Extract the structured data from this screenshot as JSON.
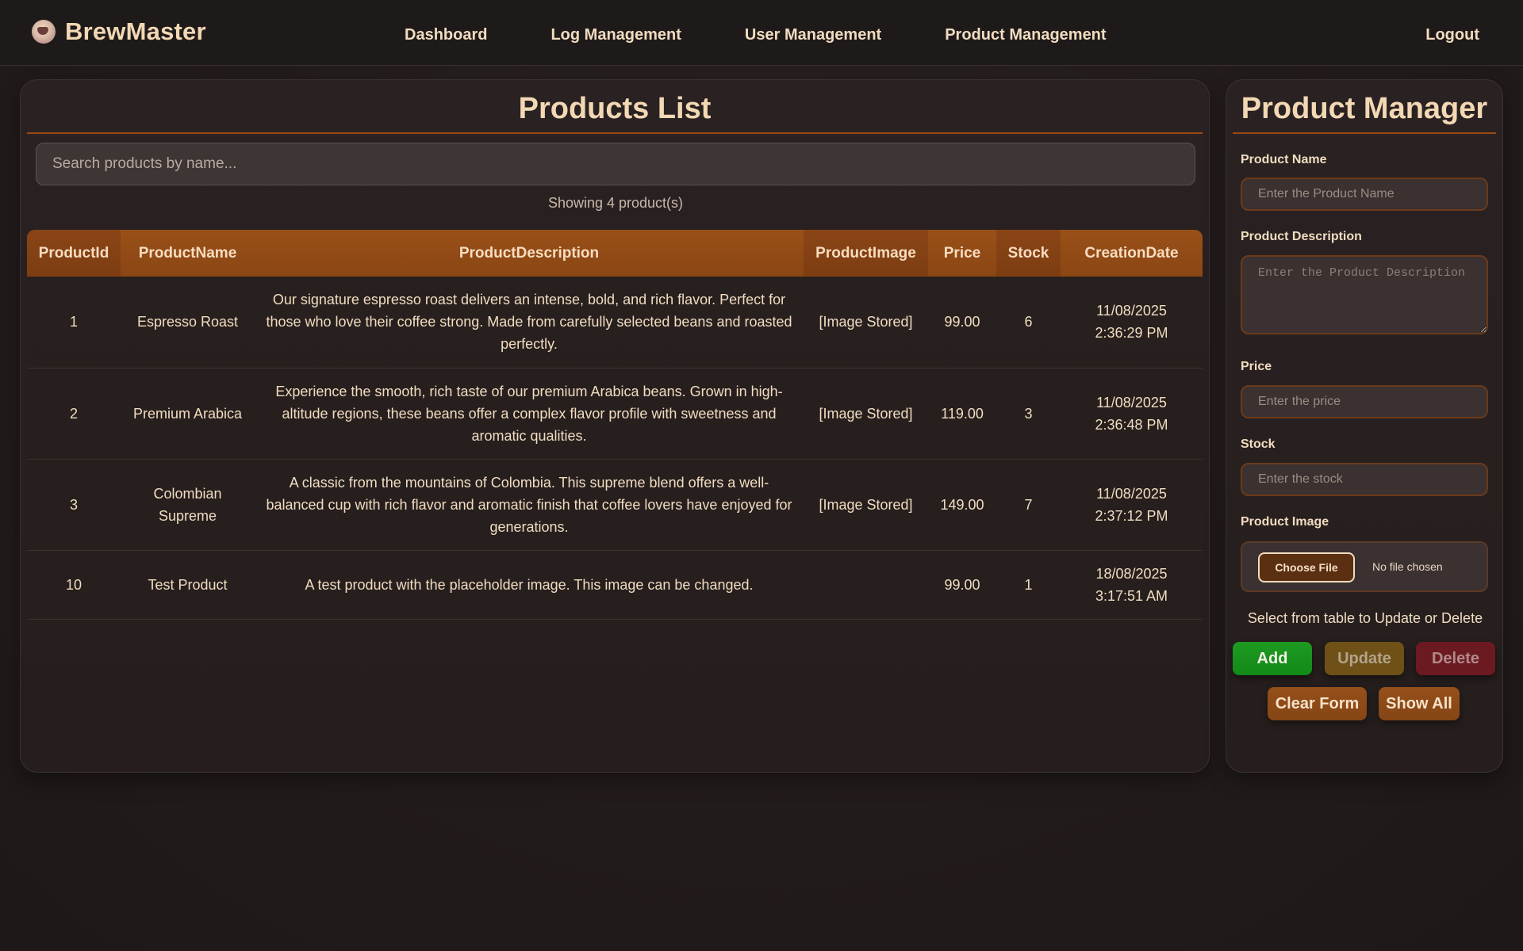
{
  "app": {
    "brand": "BrewMaster"
  },
  "nav": {
    "links": [
      "Dashboard",
      "Log Management",
      "User Management",
      "Product Management"
    ],
    "logout": "Logout"
  },
  "products_list": {
    "title": "Products List",
    "search_placeholder": "Search products by name...",
    "showing": "Showing 4 product(s)",
    "columns": [
      "ProductId",
      "ProductName",
      "ProductDescription",
      "ProductImage",
      "Price",
      "Stock",
      "CreationDate"
    ],
    "rows": [
      {
        "id": "1",
        "name": "Espresso Roast",
        "description": "Our signature espresso roast delivers an intense, bold, and rich flavor. Perfect for those who love their coffee strong. Made from carefully selected beans and roasted perfectly.",
        "image": "[Image Stored]",
        "price": "99.00",
        "stock": "6",
        "date": "11/08/2025",
        "time": "2:36:29 PM"
      },
      {
        "id": "2",
        "name": "Premium Arabica",
        "description": "Experience the smooth, rich taste of our premium Arabica beans. Grown in high-altitude regions, these beans offer a complex flavor profile with sweetness and aromatic qualities.",
        "image": "[Image Stored]",
        "price": "119.00",
        "stock": "3",
        "date": "11/08/2025",
        "time": "2:36:48 PM"
      },
      {
        "id": "3",
        "name": "Colombian Supreme",
        "description": "A classic from the mountains of Colombia. This supreme blend offers a well-balanced cup with rich flavor and aromatic finish that coffee lovers have enjoyed for generations.",
        "image": "[Image Stored]",
        "price": "149.00",
        "stock": "7",
        "date": "11/08/2025",
        "time": "2:37:12 PM"
      },
      {
        "id": "10",
        "name": "Test Product",
        "description": "A test product with the placeholder image. This image can be changed.",
        "image": "",
        "price": "99.00",
        "stock": "1",
        "date": "18/08/2025",
        "time": "3:17:51 AM"
      }
    ]
  },
  "manager": {
    "title": "Product Manager",
    "product_name_label": "Product Name",
    "product_name_placeholder": "Enter the Product Name",
    "description_label": "Product Description",
    "description_placeholder": "Enter the Product Description",
    "price_label": "Price",
    "price_placeholder": "Enter the price",
    "stock_label": "Stock",
    "stock_placeholder": "Enter the stock",
    "image_label": "Product Image",
    "choose_file": "Choose File",
    "no_file": "No file chosen",
    "hint": "Select from table to Update or Delete",
    "add": "Add",
    "update": "Update",
    "delete": "Delete",
    "clear": "Clear Form",
    "show_all": "Show All"
  },
  "colors": {
    "accent": "#8a4515",
    "add_green": "#1e9a22",
    "update_gold": "#6f5118",
    "delete_red": "#6c1a22"
  }
}
